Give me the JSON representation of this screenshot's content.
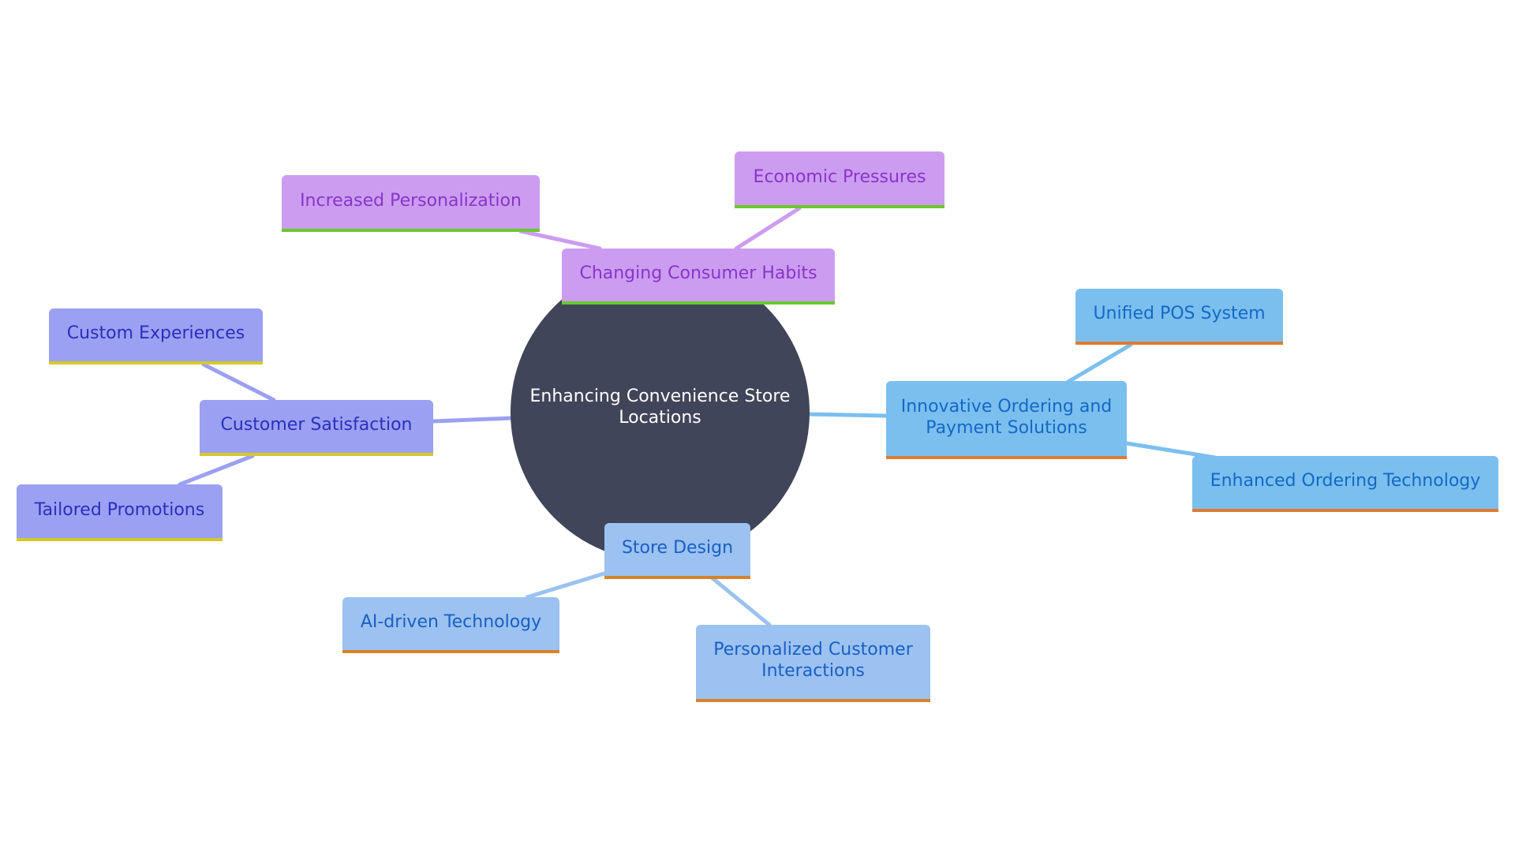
{
  "diagram": {
    "type": "mind-map",
    "root": {
      "label": "Enhancing Convenience Store Locations",
      "color": "#414559",
      "text_color": "#ffffff"
    },
    "branches": {
      "changing": {
        "label": "Changing Consumer Habits",
        "colors": {
          "fill": "#cc9cf1",
          "text": "#8736c8",
          "underline": "#69c92b",
          "edge": "#cc9cf1"
        },
        "children": [
          {
            "label": "Increased Personalization"
          },
          {
            "label": "Economic Pressures"
          }
        ]
      },
      "innovative": {
        "label": "Innovative Ordering and Payment Solutions",
        "colors": {
          "fill": "#7bbfef",
          "text": "#1568c4",
          "underline": "#e07b2f",
          "edge": "#7bbfef"
        },
        "children": [
          {
            "label": "Unified POS System"
          },
          {
            "label": "Enhanced Ordering Technology"
          }
        ]
      },
      "satisfaction": {
        "label": "Customer Satisfaction",
        "colors": {
          "fill": "#9ba0f2",
          "text": "#2a2fbd",
          "underline": "#d5c928",
          "edge": "#9ba0f2"
        },
        "children": [
          {
            "label": "Custom Experiences"
          },
          {
            "label": "Tailored Promotions"
          }
        ]
      },
      "store": {
        "label": "Store Design",
        "colors": {
          "fill": "#9bc2f0",
          "text": "#1a5fc4",
          "underline": "#d7822a",
          "edge": "#9bc2f0"
        },
        "children": [
          {
            "label": "AI-driven Technology"
          },
          {
            "label": "Personalized Customer Interactions"
          }
        ]
      }
    }
  }
}
